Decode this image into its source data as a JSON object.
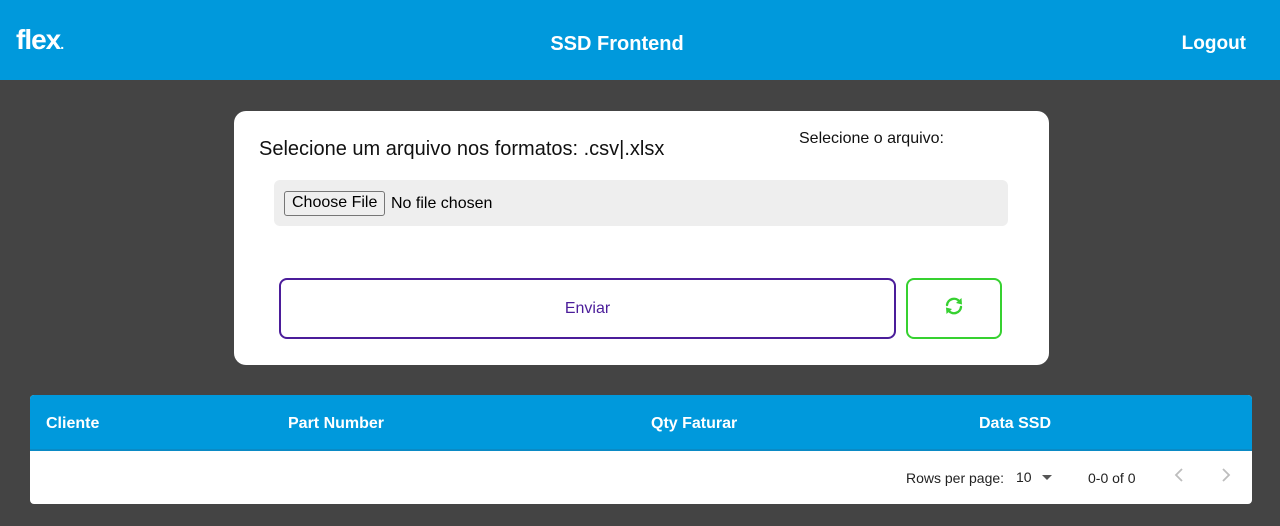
{
  "header": {
    "logo_text": "flex",
    "logo_dot": ".",
    "title": "SSD Frontend",
    "logout_label": "Logout",
    "background_color": "#0099dc"
  },
  "upload": {
    "instruction": "Selecione um arquivo nos formatos: .csv|.xlsx",
    "file_label": "Selecione o arquivo:",
    "choose_file_label": "Choose File",
    "no_file_text": "No file chosen",
    "send_label": "Enviar",
    "refresh_icon": "refresh-icon",
    "send_color": "#4b1d9a",
    "refresh_color": "#36d130"
  },
  "table": {
    "columns": [
      "Cliente",
      "Part Number",
      "Qty Faturar",
      "Data SSD"
    ],
    "rows": [],
    "pagination": {
      "rows_per_page_label": "Rows per page:",
      "rows_per_page_value": "10",
      "range_text": "0-0 of 0",
      "prev_icon": "chevron-left-icon",
      "next_icon": "chevron-right-icon"
    }
  }
}
